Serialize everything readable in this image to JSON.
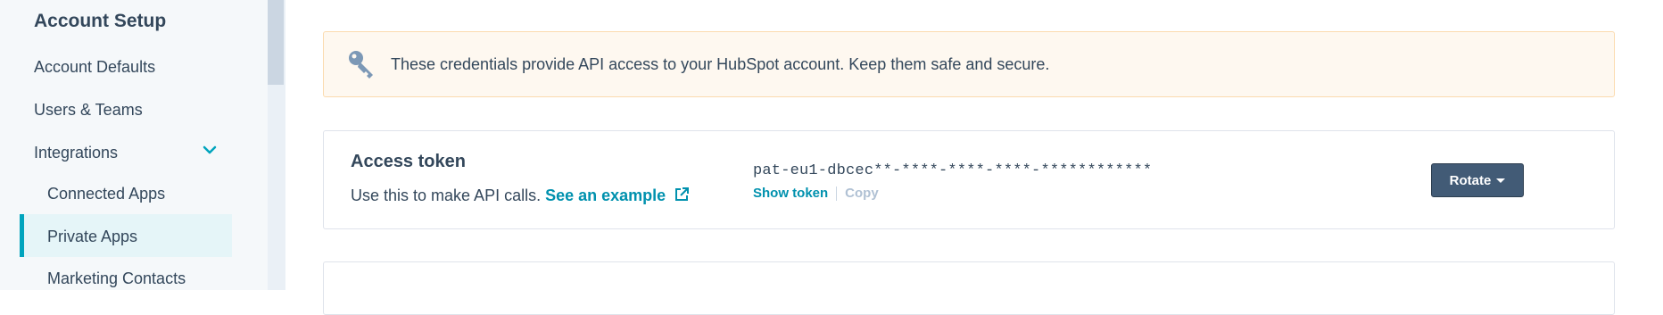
{
  "sidebar": {
    "heading": "Account Setup",
    "items": [
      {
        "label": "Account Defaults"
      },
      {
        "label": "Users & Teams"
      },
      {
        "label": "Integrations"
      }
    ],
    "sub_items": [
      {
        "label": "Connected Apps"
      },
      {
        "label": "Private Apps",
        "active": true
      },
      {
        "label": "Marketing Contacts"
      }
    ]
  },
  "alert": {
    "text": "These credentials provide API access to your HubSpot account. Keep them safe and secure.",
    "icon": "key-icon"
  },
  "access_token": {
    "title": "Access token",
    "description": "Use this to make API calls.",
    "link_label": "See an example",
    "token_value": "pat-eu1-dbcec**-****-****-****-************",
    "show_token_label": "Show token",
    "copy_label": "Copy",
    "rotate_label": "Rotate"
  },
  "colors": {
    "accent": "#00a4bd",
    "link": "#0091ae",
    "button": "#425b76",
    "alert_bg": "#fef8f0"
  }
}
